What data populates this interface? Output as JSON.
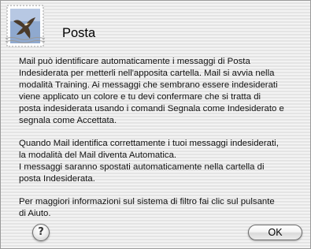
{
  "dialog": {
    "app_icon": "mail-stamp-eagle-icon",
    "title": "Posta",
    "paragraphs": [
      {
        "lines": [
          "Mail può identificare automaticamente i messaggi di Posta",
          "Indesiderata per metterli nell'apposita cartella. Mail si avvia nella",
          "modalità Training. Ai messaggi che sembrano essere indesiderati",
          "viene applicato un colore e tu devi confermare che si tratta di",
          "posta indesiderata usando i comandi Segnala come Indesiderato e",
          "segnala come Accettata."
        ]
      },
      {
        "lines": [
          "Quando Mail identifica correttamente i tuoi messaggi indesiderati,",
          "la modalità del Mail diventa Automatica.",
          "I messaggi saranno spostati automaticamente nella cartella di",
          "posta Indesiderata."
        ]
      },
      {
        "lines": [
          "Per maggiori informazioni sul sistema di filtro fai clic sul pulsante",
          "di Aiuto."
        ]
      }
    ],
    "help_button_label": "?",
    "ok_button_label": "OK"
  }
}
